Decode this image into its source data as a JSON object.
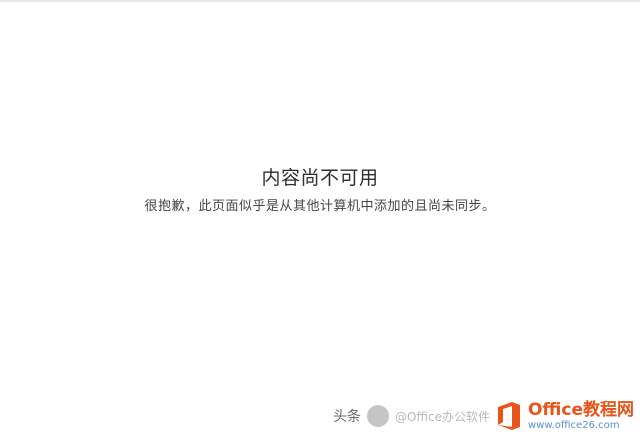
{
  "message": {
    "title": "内容尚不可用",
    "description": "很抱歉，此页面似乎是从其他计算机中添加的且尚未同步。"
  },
  "watermark": {
    "platform": "头条",
    "source": "@Office办公软件",
    "brand": "Office教程网",
    "url": "www.office26.com",
    "brand_color": "#e8541a"
  }
}
